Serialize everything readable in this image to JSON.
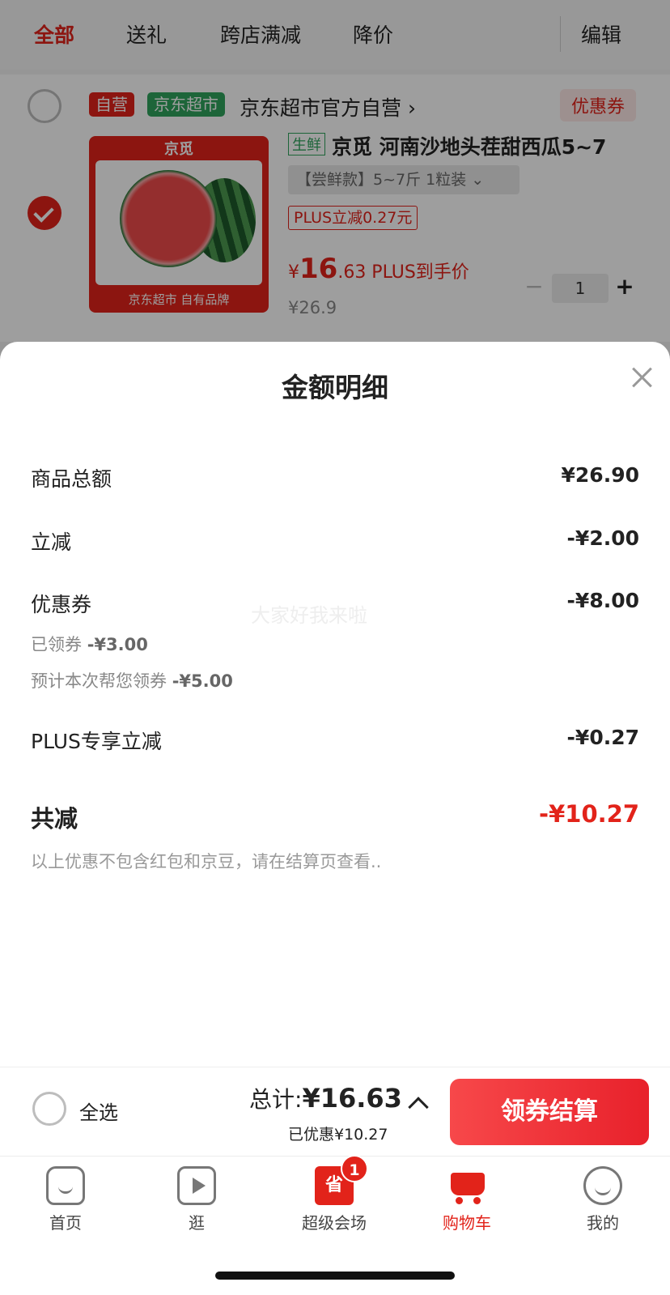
{
  "tabs": [
    {
      "label": "全部",
      "active": true
    },
    {
      "label": "送礼"
    },
    {
      "label": "跨店满减"
    },
    {
      "label": "降价"
    }
  ],
  "edit_label": "编辑",
  "shop": {
    "badge_self": "自营",
    "badge_market": "京东超市",
    "name": "京东超市官方自营 ›",
    "coupon_tag": "优惠券"
  },
  "item": {
    "fresh_tag": "生鲜",
    "title": "京觅 河南沙地头茬甜西瓜5~7",
    "spec": "【尝鲜款】5~7斤 1粒装  ⌄",
    "plus_tag": "PLUS立减0.27元",
    "price_symbol": "¥",
    "price_int": "16",
    "price_dec": ".63 PLUS到手价",
    "orig_price": "¥26.9",
    "quantity": "1",
    "thumb_logo": "京觅",
    "thumb_foot": "京东超市 自有品牌"
  },
  "sheet": {
    "title": "金额明细",
    "watermark": "大家好我来啦",
    "rows": {
      "goods_total_label": "商品总额",
      "goods_total_value": "¥26.90",
      "direct_label": "立减",
      "direct_value": "-¥2.00",
      "coupon_label": "优惠券",
      "coupon_value": "-¥8.00",
      "coupon_claimed_label": "已领券",
      "coupon_claimed_value": "-¥3.00",
      "coupon_predict_label": "预计本次帮您领券",
      "coupon_predict_value": "-¥5.00",
      "plus_label": "PLUS专享立减",
      "plus_value": "-¥0.27",
      "total_label": "共减",
      "total_value": "-¥10.27",
      "note": "以上优惠不包含红包和京豆，请在结算页查看.."
    }
  },
  "checkout": {
    "select_all": "全选",
    "total_prefix": "总计:",
    "total_value": "¥16.63",
    "saved": "已优惠¥10.27",
    "pay_button": "领券结算"
  },
  "nav": {
    "home": "首页",
    "browse": "逛",
    "super": "超级会场",
    "super_icon_char": "省",
    "super_badge": "1",
    "cart": "购物车",
    "me": "我的"
  }
}
